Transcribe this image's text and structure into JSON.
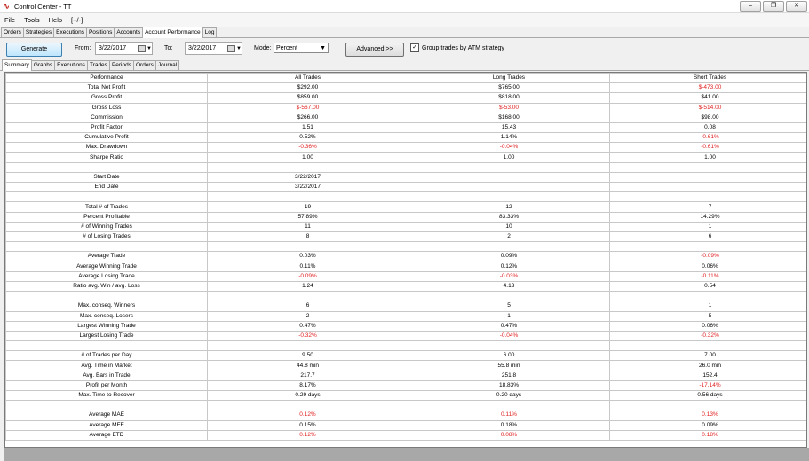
{
  "window": {
    "title": "Control Center - TT",
    "minimize_label": "‒",
    "restore_label": "❐",
    "close_label": "✕"
  },
  "menu": [
    "File",
    "Tools",
    "Help",
    "[+/-]"
  ],
  "main_tabs": [
    "Orders",
    "Strategies",
    "Executions",
    "Positions",
    "Accounts",
    "Account Performance",
    "Log"
  ],
  "main_tab_active": 5,
  "toolbar": {
    "generate_label": "Generate",
    "from_label": "From:",
    "from_value": "3/22/2017",
    "to_label": "To:",
    "to_value": "3/22/2017",
    "mode_label": "Mode:",
    "mode_value": "Percent",
    "advanced_label": "Advanced >>",
    "atm_checked": true,
    "atm_label": "Group trades by ATM strategy"
  },
  "sub_tabs": [
    "Summary",
    "Graphs",
    "Executions",
    "Trades",
    "Periods",
    "Orders",
    "Journal"
  ],
  "sub_tab_active": 0,
  "table": {
    "headers": [
      "Performance",
      "All Trades",
      "Long Trades",
      "Short Trades"
    ],
    "rows": [
      [
        "Total Net Profit",
        "$292.00",
        "$765.00",
        "$-473.00"
      ],
      [
        "Gross Profit",
        "$859.00",
        "$818.00",
        "$41.00"
      ],
      [
        "Gross Loss",
        "$-567.00",
        "$-53.00",
        "$-514.00"
      ],
      [
        "Commission",
        "$266.00",
        "$168.00",
        "$98.00"
      ],
      [
        "Profit Factor",
        "1.51",
        "15.43",
        "0.08"
      ],
      [
        "Cumulative Profit",
        "0.52%",
        "1.14%",
        "-0.61%"
      ],
      [
        "Max. Drawdown",
        "-0.36%",
        "-0.04%",
        "-0.61%"
      ],
      [
        "Sharpe Ratio",
        "1.00",
        "1.00",
        "1.00"
      ],
      [
        "",
        "",
        "",
        ""
      ],
      [
        "Start Date",
        "3/22/2017",
        "",
        ""
      ],
      [
        "End Date",
        "3/22/2017",
        "",
        ""
      ],
      [
        "",
        "",
        "",
        ""
      ],
      [
        "Total # of Trades",
        "19",
        "12",
        "7"
      ],
      [
        "Percent Profitable",
        "57.89%",
        "83.33%",
        "14.29%"
      ],
      [
        "# of Winning Trades",
        "11",
        "10",
        "1"
      ],
      [
        "# of Losing Trades",
        "8",
        "2",
        "6"
      ],
      [
        "",
        "",
        "",
        ""
      ],
      [
        "Average Trade",
        "0.03%",
        "0.09%",
        "-0.09%"
      ],
      [
        "Average Winning Trade",
        "0.11%",
        "0.12%",
        "0.06%"
      ],
      [
        "Average Losing Trade",
        "-0.09%",
        "-0.03%",
        "-0.11%"
      ],
      [
        "Ratio avg. Win / avg. Loss",
        "1.24",
        "4.13",
        "0.54"
      ],
      [
        "",
        "",
        "",
        ""
      ],
      [
        "Max. conseq. Winners",
        "6",
        "5",
        "1"
      ],
      [
        "Max. conseq. Losers",
        "2",
        "1",
        "5"
      ],
      [
        "Largest Winning Trade",
        "0.47%",
        "0.47%",
        "0.06%"
      ],
      [
        "Largest Losing Trade",
        "-0.32%",
        "-0.04%",
        "-0.32%"
      ],
      [
        "",
        "",
        "",
        ""
      ],
      [
        "# of Trades per Day",
        "9.50",
        "6.00",
        "7.00"
      ],
      [
        "Avg. Time in Market",
        "44.8 min",
        "55.8 min",
        "26.0 min"
      ],
      [
        "Avg. Bars in Trade",
        "217.7",
        "251.8",
        "152.4"
      ],
      [
        "Profit per Month",
        "8.17%",
        "18.83%",
        "-17.14%"
      ],
      [
        "Max. Time to Recover",
        "0.29 days",
        "0.20 days",
        "0.56 days"
      ],
      [
        "",
        "",
        "",
        ""
      ],
      [
        "Average MAE",
        "0.12%",
        "0.11%",
        "0.13%"
      ],
      [
        "Average MFE",
        "0.15%",
        "0.18%",
        "0.09%"
      ],
      [
        "Average ETD",
        "0.12%",
        "0.08%",
        "0.18%"
      ]
    ],
    "red_cells": [
      [
        0,
        3
      ],
      [
        2,
        1
      ],
      [
        2,
        2
      ],
      [
        2,
        3
      ],
      [
        5,
        3
      ],
      [
        6,
        1
      ],
      [
        6,
        2
      ],
      [
        6,
        3
      ],
      [
        17,
        3
      ],
      [
        19,
        1
      ],
      [
        19,
        2
      ],
      [
        19,
        3
      ],
      [
        25,
        1
      ],
      [
        25,
        2
      ],
      [
        25,
        3
      ],
      [
        30,
        3
      ],
      [
        33,
        1
      ],
      [
        33,
        2
      ],
      [
        33,
        3
      ],
      [
        35,
        1
      ],
      [
        35,
        2
      ],
      [
        35,
        3
      ]
    ],
    "negative_color": "#e02020"
  }
}
